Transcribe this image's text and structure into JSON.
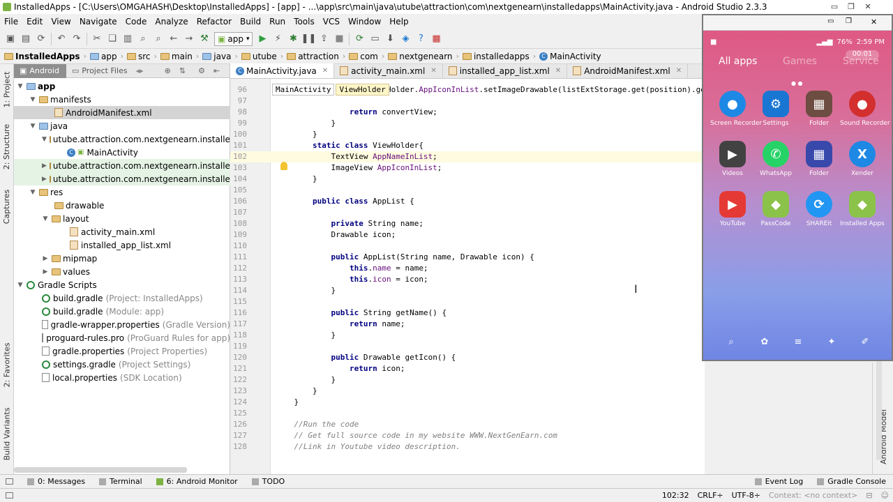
{
  "window": {
    "title": "InstalledApps - [C:\\Users\\OMGAHASH\\Desktop\\InstalledApps] - [app] - ...\\app\\src\\main\\java\\utube\\attraction\\com\\nextgenearn\\installedapps\\MainActivity.java - Android Studio 2.3.3"
  },
  "menu": [
    "File",
    "Edit",
    "View",
    "Navigate",
    "Code",
    "Analyze",
    "Refactor",
    "Build",
    "Run",
    "Tools",
    "VCS",
    "Window",
    "Help"
  ],
  "toolbar": {
    "run_config": "app"
  },
  "navbar": [
    "InstalledApps",
    "app",
    "src",
    "main",
    "java",
    "utube",
    "attraction",
    "com",
    "nextgenearn",
    "installedapps",
    "MainActivity"
  ],
  "left_strip": {
    "project": "1: Project",
    "structure": "2: Structure",
    "captures": "Captures",
    "favorites": "2: Favorites",
    "build_variants": "Build Variants"
  },
  "project_panel": {
    "tab_android": "Android",
    "tab_project_files": "Project Files",
    "tree": [
      {
        "label": "app",
        "extra": ""
      },
      {
        "label": "manifests",
        "extra": ""
      },
      {
        "label": "AndroidManifest.xml",
        "extra": ""
      },
      {
        "label": "java",
        "extra": ""
      },
      {
        "label": "utube.attraction.com.nextgenearn.installedapps",
        "extra": ""
      },
      {
        "label": "MainActivity",
        "extra": ""
      },
      {
        "label": "utube.attraction.com.nextgenearn.installedapps",
        "extra": ""
      },
      {
        "label": "utube.attraction.com.nextgenearn.installedapps",
        "extra": ""
      },
      {
        "label": "res",
        "extra": ""
      },
      {
        "label": "drawable",
        "extra": ""
      },
      {
        "label": "layout",
        "extra": ""
      },
      {
        "label": "activity_main.xml",
        "extra": ""
      },
      {
        "label": "installed_app_list.xml",
        "extra": ""
      },
      {
        "label": "mipmap",
        "extra": ""
      },
      {
        "label": "values",
        "extra": ""
      },
      {
        "label": "Gradle Scripts",
        "extra": ""
      },
      {
        "label": "build.gradle",
        "extra": "(Project: InstalledApps)"
      },
      {
        "label": "build.gradle",
        "extra": "(Module: app)"
      },
      {
        "label": "gradle-wrapper.properties",
        "extra": "(Gradle Version)"
      },
      {
        "label": "proguard-rules.pro",
        "extra": "(ProGuard Rules for app)"
      },
      {
        "label": "gradle.properties",
        "extra": "(Project Properties)"
      },
      {
        "label": "settings.gradle",
        "extra": "(Project Settings)"
      },
      {
        "label": "local.properties",
        "extra": "(SDK Location)"
      }
    ]
  },
  "editor": {
    "tabs": [
      "MainActivity.java",
      "activity_main.xml",
      "installed_app_list.xml",
      "AndroidManifest.xml"
    ],
    "crumbs": [
      "MainActivity",
      "ViewHolder"
    ],
    "lines": [
      {
        "n": "96",
        "code": "                listViewHolder.AppIconInList.setImageDrawable(listExtStorage.get(position).getIco"
      },
      {
        "n": "97",
        "code": ""
      },
      {
        "n": "98",
        "code": "                return convertView;"
      },
      {
        "n": "99",
        "code": "            }"
      },
      {
        "n": "100",
        "code": "        }"
      },
      {
        "n": "101",
        "code": "        static class ViewHolder{"
      },
      {
        "n": "102",
        "code": "            TextView AppNameInList;"
      },
      {
        "n": "103",
        "code": "            ImageView AppIconInList;"
      },
      {
        "n": "104",
        "code": "        }"
      },
      {
        "n": "105",
        "code": ""
      },
      {
        "n": "106",
        "code": "        public class AppList {"
      },
      {
        "n": "107",
        "code": ""
      },
      {
        "n": "108",
        "code": "            private String name;"
      },
      {
        "n": "109",
        "code": "            Drawable icon;"
      },
      {
        "n": "110",
        "code": ""
      },
      {
        "n": "111",
        "code": "            public AppList(String name, Drawable icon) {"
      },
      {
        "n": "112",
        "code": "                this.name = name;"
      },
      {
        "n": "113",
        "code": "                this.icon = icon;"
      },
      {
        "n": "114",
        "code": "            }"
      },
      {
        "n": "115",
        "code": ""
      },
      {
        "n": "116",
        "code": "            public String getName() {"
      },
      {
        "n": "117",
        "code": "                return name;"
      },
      {
        "n": "118",
        "code": "            }"
      },
      {
        "n": "119",
        "code": ""
      },
      {
        "n": "120",
        "code": "            public Drawable getIcon() {"
      },
      {
        "n": "121",
        "code": "                return icon;"
      },
      {
        "n": "122",
        "code": "            }"
      },
      {
        "n": "123",
        "code": "        }"
      },
      {
        "n": "124",
        "code": "    }"
      },
      {
        "n": "125",
        "code": ""
      },
      {
        "n": "126",
        "code": "    //Run the code"
      },
      {
        "n": "127",
        "code": "    // Get full source code in my website WWW.NextGenEarn.com"
      },
      {
        "n": "128",
        "code": "    //Link in Youtube video description."
      }
    ]
  },
  "right_strip": {
    "android_model": "Android Model"
  },
  "phone": {
    "time": "2:59 PM",
    "battery": "76%",
    "recording": "00:01",
    "tabs": [
      "All apps",
      "Games",
      "Service"
    ],
    "apps": [
      {
        "label": "Screen Recorder",
        "color": "#1e88e5",
        "glyph": "●"
      },
      {
        "label": "Settings",
        "color": "#1976d2",
        "glyph": "⚙"
      },
      {
        "label": "Folder",
        "color": "#6d4c41",
        "glyph": "▦"
      },
      {
        "label": "Sound Recorder",
        "color": "#d32f2f",
        "glyph": "●"
      },
      {
        "label": "Videos",
        "color": "#424242",
        "glyph": "▶"
      },
      {
        "label": "WhatsApp",
        "color": "#25d366",
        "glyph": "✆"
      },
      {
        "label": "Folder",
        "color": "#3949ab",
        "glyph": "▦"
      },
      {
        "label": "Xender",
        "color": "#1e88e5",
        "glyph": "X"
      },
      {
        "label": "YouTube",
        "color": "#e53935",
        "glyph": "▶"
      },
      {
        "label": "PassCode",
        "color": "#8bc34a",
        "glyph": "◆"
      },
      {
        "label": "SHAREit",
        "color": "#2196f3",
        "glyph": "⟳"
      },
      {
        "label": "Installed Apps",
        "color": "#8bc34a",
        "glyph": "◆"
      }
    ]
  },
  "bottom_tools": [
    "0: Messages",
    "Terminal",
    "6: Android Monitor",
    "TODO",
    "Event Log",
    "Gradle Console"
  ],
  "status": {
    "position": "102:32",
    "line_sep": "CRLF÷",
    "encoding": "UTF-8÷",
    "context": "Context: <no context>"
  }
}
